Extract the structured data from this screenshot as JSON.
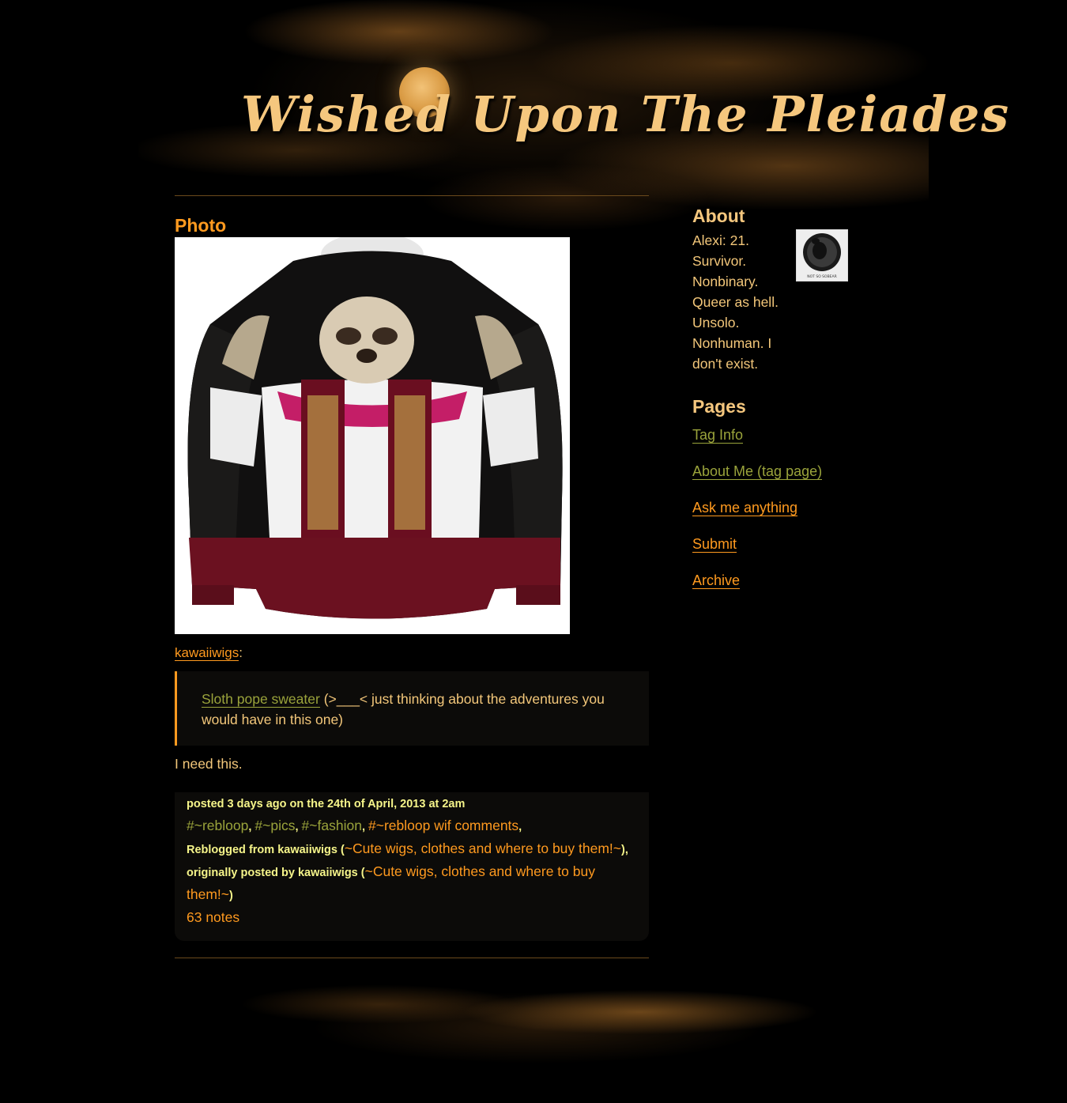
{
  "blog": {
    "title": "Wished Upon The Pleiades"
  },
  "post": {
    "type_label": "Photo",
    "photo_alt": "Sloth pope sweater",
    "source_user": "kawaiiwigs",
    "source_colon": ":",
    "quote": {
      "link_text": "Sloth pope sweater",
      "text": " (>___< just thinking about the adventures you would have in this one)"
    },
    "caption": "I need this.",
    "meta": {
      "posted": "posted 3 days ago on the 24th of April, 2013 at 2am",
      "tags": [
        {
          "label": "#~rebloop",
          "sep": ", "
        },
        {
          "label": "#~pics",
          "sep": ", "
        },
        {
          "label": "#~fashion",
          "sep": ", "
        },
        {
          "label": "#~rebloop wif comments",
          "sep": ","
        }
      ],
      "reblogged_prefix": "Reblogged from kawaiiwigs (",
      "reblogged_link": "~Cute wigs, clothes and where to buy them!~",
      "originally_prefix": "), originally posted by kawaiiwigs (",
      "originally_link": "~Cute wigs, clothes and where to buy them!~",
      "originally_suffix": ")",
      "notes": "63 notes"
    }
  },
  "sidebar": {
    "about_heading": "About",
    "about_text": "Alexi: 21. Survivor. Nonbinary. Queer as hell. Unsolo. Nonhuman. I don't exist.",
    "avatar_caption": "NOT SO SOBEAR",
    "pages_heading": "Pages",
    "pages": [
      {
        "label": "Tag Info",
        "style": "olive"
      },
      {
        "label": "About Me (tag page)",
        "style": "olive"
      },
      {
        "label": "Ask me anything",
        "style": "orange"
      },
      {
        "label": "Submit",
        "style": "orange"
      },
      {
        "label": "Archive",
        "style": "orange"
      }
    ]
  },
  "colors": {
    "accent": "#ff9a1f",
    "text": "#f3c77a",
    "olive_link": "#9aa33b",
    "meta_highlight": "#f6f58a",
    "background": "#000000"
  }
}
